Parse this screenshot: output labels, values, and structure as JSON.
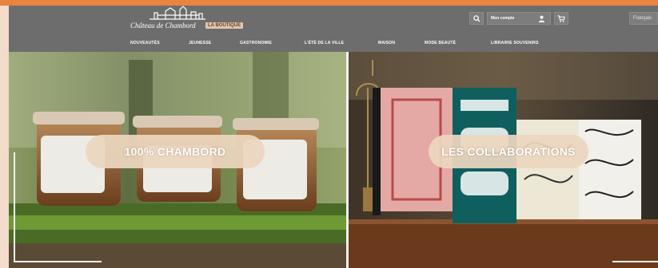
{
  "header": {
    "logo_text": "Château de Chambord",
    "logo_badge": "LA BOUTIQUE",
    "account_label": "Mon compte",
    "language": "Français"
  },
  "nav": {
    "items": [
      "NOUVEAUTÉS",
      "JEUNESSE",
      "GASTRONOMIE",
      "L'ÉTÉ DE LA VILLE",
      "MAISON",
      "MODE BEAUTÉ",
      "LIBRAIRIE SOUVENIRS"
    ]
  },
  "icons": {
    "search": "search-icon",
    "user": "user-icon",
    "cart": "cart-icon"
  },
  "colors": {
    "accent": "#e9843f",
    "header": "#6d6d6d",
    "button": "#ecd6be"
  },
  "banners": {
    "left_label": "100% CHAMBORD",
    "right_label": "LES COLLABORATIONS"
  }
}
